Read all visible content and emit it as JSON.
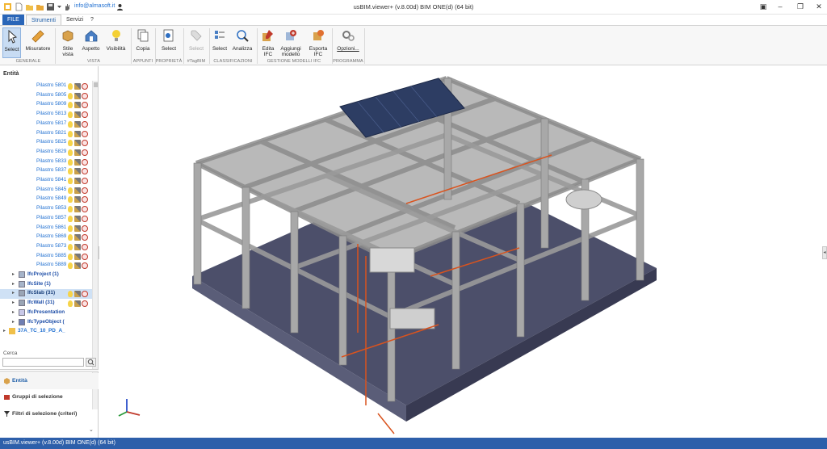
{
  "window": {
    "title": "usBIM.viewer+ (v.8.00d)  BIM ONE(d) (64 bit)",
    "email": "info@almasoft.it",
    "controls": [
      "minimize-icon",
      "restore-icon",
      "maximize-icon",
      "close-icon"
    ]
  },
  "tabs": [
    {
      "label": "FILE"
    },
    {
      "label": "Strumenti"
    },
    {
      "label": "Servizi"
    },
    {
      "label": "?"
    }
  ],
  "ribbon": {
    "groups": [
      {
        "label": "GENERALE"
      },
      {
        "label": "VISTA"
      },
      {
        "label": "APPUNTI"
      },
      {
        "label": "PROPRIETÀ"
      },
      {
        "label": "#TagBIM"
      },
      {
        "label": "CLASSIFICAZIONI"
      },
      {
        "label": "GESTIONE MODELLI IFC"
      },
      {
        "label": "PROGRAMMA"
      }
    ],
    "buttons": [
      {
        "label": "Select",
        "icon": "cursor-icon"
      },
      {
        "label": "Misuratore",
        "icon": "ruler-icon"
      },
      {
        "label": "Stile\nvista",
        "icon": "box-icon"
      },
      {
        "label": "Aspetto",
        "icon": "house-icon"
      },
      {
        "label": "Visibilità",
        "icon": "bulb-icon"
      },
      {
        "label": "Copia",
        "icon": "copy-icon"
      },
      {
        "label": "Select",
        "icon": "properties-icon"
      },
      {
        "label": "Select",
        "icon": "tag-icon"
      },
      {
        "label": "Select",
        "icon": "classify-icon"
      },
      {
        "label": "Analizza",
        "icon": "analyze-icon"
      },
      {
        "label": "Edita\nIFC",
        "icon": "edit-ifc-icon"
      },
      {
        "label": "Aggiungi\nmodello",
        "icon": "add-model-icon"
      },
      {
        "label": "Esporta\nIFC",
        "icon": "export-ifc-icon"
      },
      {
        "label": "Opzioni...",
        "icon": "gears-icon"
      }
    ]
  },
  "panel": {
    "header": "Entità",
    "pilastri": [
      "Pilastro 5801",
      "Pilastro 5805",
      "Pilastro 5809",
      "Pilastro 5813",
      "Pilastro 5817",
      "Pilastro 5821",
      "Pilastro 5825",
      "Pilastro 5829",
      "Pilastro 5833",
      "Pilastro 5837",
      "Pilastro 5841",
      "Pilastro 5845",
      "Pilastro 5849",
      "Pilastro 5853",
      "Pilastro 5857",
      "Pilastro 5861",
      "Pilastro 5869",
      "Pilastro 5873",
      "Pilastro 5885",
      "Pilastro 5889"
    ],
    "ifc_nodes": [
      "IfcProject (1)",
      "IfcSite (1)",
      "IfcSlab (31)",
      "IfcWall (31)",
      "IfcPresentation",
      "IfcTypeObject ("
    ],
    "model_node": "37A_TC_10_PD_A_",
    "search_label": "Cerca",
    "nav": [
      {
        "label": "Entità",
        "icon": "entity-icon"
      },
      {
        "label": "Gruppi di selezione",
        "icon": "group-icon"
      },
      {
        "label": "Filtri di selezione (criteri)",
        "icon": "filter-icon"
      }
    ]
  },
  "status": "usBIM.viewer+ (v.8.00d)  BIM ONE(d) (64 bit)",
  "colors": {
    "accent": "#2a66b8",
    "status": "#2d5faa",
    "link": "#1f6fd1",
    "selection": "#cfe1f5"
  }
}
